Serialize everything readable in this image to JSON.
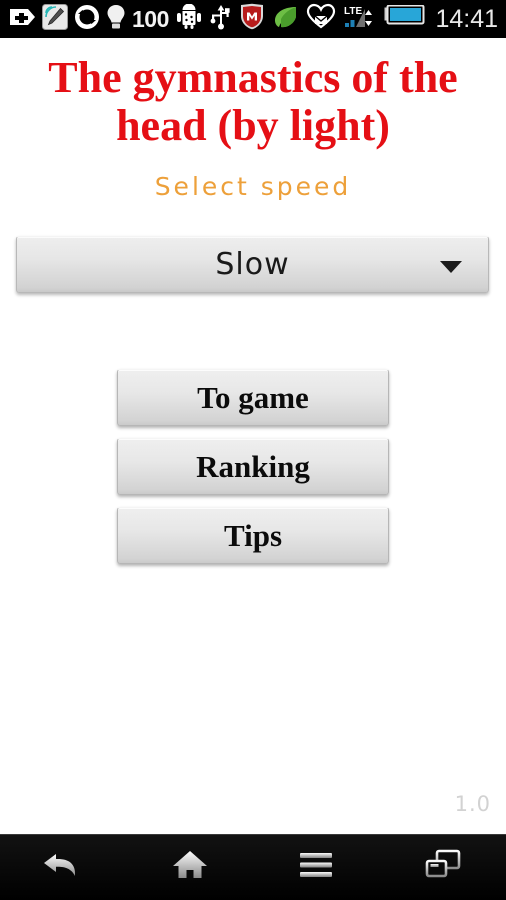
{
  "status_bar": {
    "battery_percent": "100",
    "clock": "14:41",
    "icons_left": [
      {
        "name": "add-plus-icon",
        "label": "add"
      },
      {
        "name": "stylus-pen-icon",
        "label": "stylus"
      },
      {
        "name": "sync-icon",
        "label": "sync"
      },
      {
        "name": "lightbulb-icon",
        "label": "lightbulb"
      },
      {
        "name": "android-usb-debug-icon",
        "label": "android"
      },
      {
        "name": "usb-icon",
        "label": "usb"
      },
      {
        "name": "mcafee-shield-icon",
        "label": "mcafee"
      },
      {
        "name": "leaf-icon",
        "label": "leaf"
      }
    ],
    "icons_right": [
      {
        "name": "heart-envelope-icon",
        "label": "message"
      },
      {
        "name": "lte-signal-icon",
        "label": "LTE"
      },
      {
        "name": "battery-icon",
        "label": "battery"
      }
    ],
    "lte_label": "LTE"
  },
  "app": {
    "title": "The gymnastics of the head (by light)",
    "version": "1.0",
    "title_color": "#e50f15",
    "label_color": "#eda03a"
  },
  "speed": {
    "label": "Select speed",
    "selected": "Slow",
    "options": [
      "Slow"
    ]
  },
  "buttons": [
    {
      "id": "to-game",
      "label": "To game"
    },
    {
      "id": "ranking",
      "label": "Ranking"
    },
    {
      "id": "tips",
      "label": "Tips"
    }
  ],
  "nav_bar": {
    "items": [
      {
        "name": "back-icon",
        "label": "Back"
      },
      {
        "name": "home-icon",
        "label": "Home"
      },
      {
        "name": "menu-icon",
        "label": "Menu"
      },
      {
        "name": "recent-apps-icon",
        "label": "Recent apps"
      }
    ]
  }
}
